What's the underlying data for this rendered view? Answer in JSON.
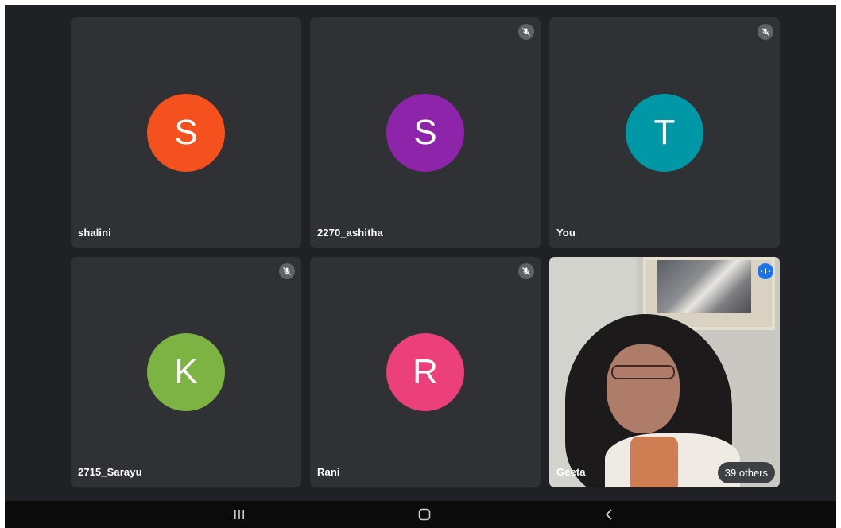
{
  "participants": [
    {
      "name": "shalini",
      "initial": "S",
      "color": "#f4511e",
      "muted": false
    },
    {
      "name": "2270_ashitha",
      "initial": "S",
      "color": "#8e24aa",
      "muted": true
    },
    {
      "name": "You",
      "initial": "T",
      "color": "#0097a7",
      "muted": true
    },
    {
      "name": "2715_Sarayu",
      "initial": "K",
      "color": "#7cb342",
      "muted": true
    },
    {
      "name": "Rani",
      "initial": "R",
      "color": "#ec407a",
      "muted": true
    },
    {
      "name": "Geeta",
      "video": true,
      "speaking": true
    }
  ],
  "others_label": "39 others",
  "navbar": {
    "recents_icon": "recent-apps-icon",
    "home_icon": "home-icon",
    "back_icon": "back-icon"
  }
}
